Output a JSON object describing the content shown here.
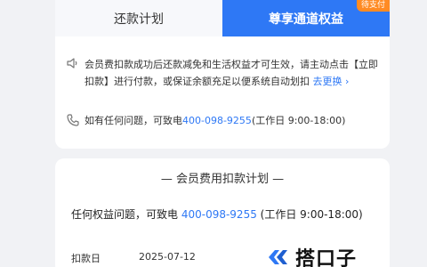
{
  "tabs": [
    {
      "label": "还款计划",
      "active": false
    },
    {
      "label": "尊享通道权益",
      "active": true,
      "badge": "待支付"
    }
  ],
  "notice": {
    "text": "会员费扣款成功后还款减免和生活权益才可生效，请主动点击【立即扣款】进行付款，或保证余额充足以便系统自动划扣",
    "link": "去更换 ›"
  },
  "contact": {
    "prefix": "如有任何问题，可致电",
    "phone": "400-098-9255",
    "suffix": "(工作日 9:00-18:00)"
  },
  "plan": {
    "title": "— 会员费用扣款计划 —",
    "contact_prefix": "任何权益问题，可致电 ",
    "phone": "400-098-9255",
    "contact_suffix": " (工作日 9:00-18:00)",
    "rows": [
      {
        "label": "扣款日",
        "value": "2025-07-12"
      }
    ]
  },
  "logo": {
    "text": "搭口子",
    "icon": "logo-mark-icon"
  },
  "colors": {
    "accent": "#2e78f5",
    "badge": "#ff8b23",
    "background": "#f1f2f5"
  }
}
